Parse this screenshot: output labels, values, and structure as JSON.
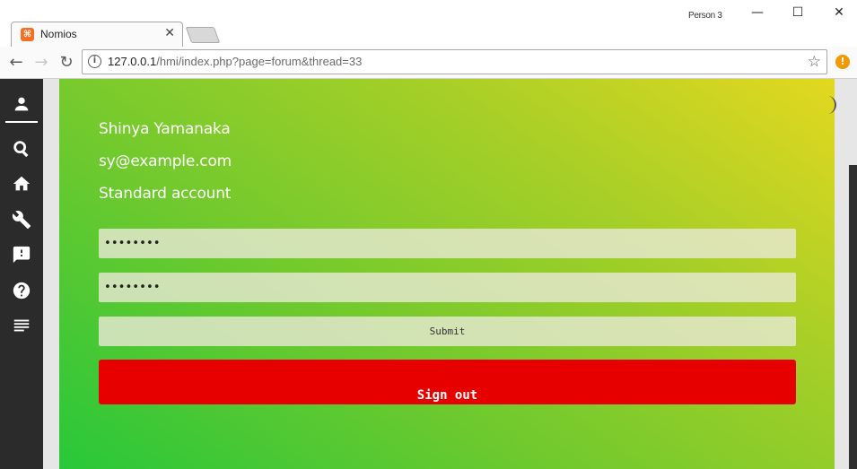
{
  "browser": {
    "tab_title": "Nomios",
    "profile_name": "Person 3",
    "url_host": "127.0.0.1",
    "url_path": "/hmi/index.php?page=forum&thread=33",
    "menu_badge": "!"
  },
  "sidebar": {
    "items": [
      {
        "name": "account",
        "icon": "person-icon"
      },
      {
        "name": "search",
        "icon": "search-icon"
      },
      {
        "name": "home",
        "icon": "home-icon"
      },
      {
        "name": "tools",
        "icon": "wrench-icon"
      },
      {
        "name": "feedback",
        "icon": "feedback-icon"
      },
      {
        "name": "help",
        "icon": "help-icon"
      },
      {
        "name": "menu",
        "icon": "list-icon"
      }
    ]
  },
  "profile": {
    "name": "Shinya Yamanaka",
    "email": "sy@example.com",
    "account_type": "Standard account"
  },
  "form": {
    "password_value": "••••••••",
    "confirm_value": "••••••••",
    "submit_label": "Submit",
    "signout_label": "Sign out"
  },
  "colors": {
    "sidebar": "#2b2b2b",
    "gradient_top": "#e3d81f",
    "gradient_bottom": "#28c83a",
    "signout": "#e60000"
  }
}
